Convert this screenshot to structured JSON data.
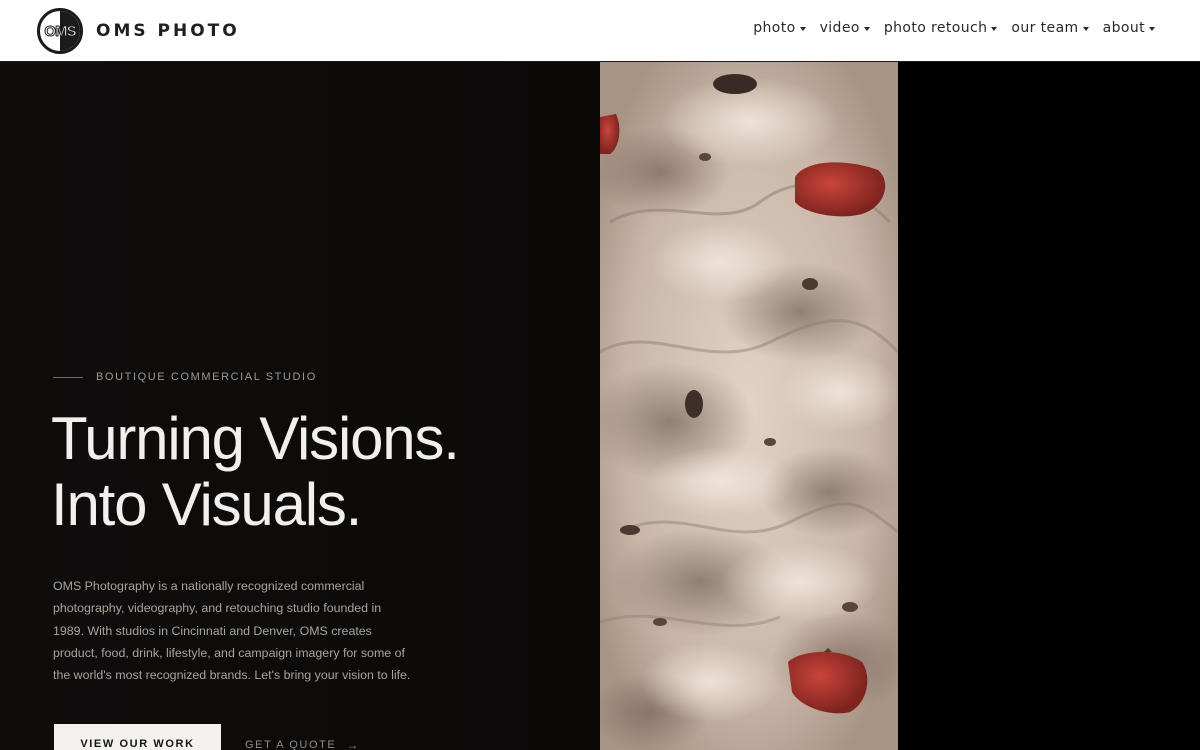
{
  "brand": {
    "logo_monogram": "OMS",
    "name": "OMS PHOTO"
  },
  "nav": {
    "items": [
      {
        "label": "photo"
      },
      {
        "label": "video"
      },
      {
        "label": "photo retouch"
      },
      {
        "label": "our team"
      },
      {
        "label": "about"
      }
    ]
  },
  "hero": {
    "eyebrow": "BOUTIQUE COMMERCIAL STUDIO",
    "headline_line1": "Turning Visions.",
    "headline_line2": "Into Visuals.",
    "description": "OMS Photography is a nationally recognized commercial photography, videography, and retouching studio founded in 1989. With studios in Cincinnati and Denver, OMS creates product, food, drink, lifestyle, and campaign imagery for some of the world's most recognized brands. Let's bring your vision to life.",
    "cta_primary": "VIEW OUR WORK",
    "cta_secondary": "GET A QUOTE",
    "cta_secondary_arrow": "→"
  },
  "colors": {
    "header_bg": "#ffffff",
    "hero_bg": "#0d0b0a",
    "headline": "#f2f0ed",
    "body_text": "#aaa39c",
    "button_bg": "#f4f2ef",
    "photo_cream": "#cdbcaf",
    "photo_berry": "#a9372f"
  },
  "icons": {
    "nav_dropdown": "caret-down-icon",
    "secondary_cta": "arrow-right-icon"
  }
}
